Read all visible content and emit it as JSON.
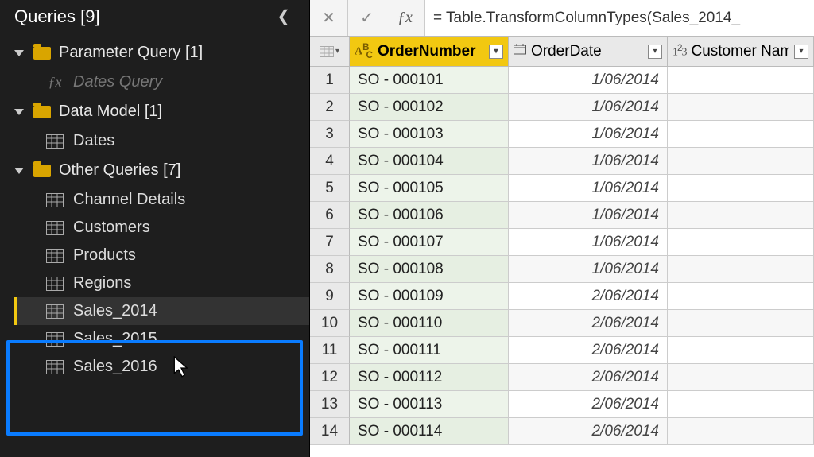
{
  "sidebar": {
    "title": "Queries [9]",
    "groups": [
      {
        "label": "Parameter Query [1]",
        "items": [
          {
            "label": "Dates Query",
            "kind": "fx",
            "dimmed": true
          }
        ]
      },
      {
        "label": "Data Model [1]",
        "items": [
          {
            "label": "Dates",
            "kind": "table"
          }
        ]
      },
      {
        "label": "Other Queries [7]",
        "items": [
          {
            "label": "Channel Details",
            "kind": "table"
          },
          {
            "label": "Customers",
            "kind": "table"
          },
          {
            "label": "Products",
            "kind": "table"
          },
          {
            "label": "Regions",
            "kind": "table"
          },
          {
            "label": "Sales_2014",
            "kind": "table",
            "selected": true
          },
          {
            "label": "Sales_2015",
            "kind": "table"
          },
          {
            "label": "Sales_2016",
            "kind": "table"
          }
        ]
      }
    ]
  },
  "formula": "= Table.TransformColumnTypes(Sales_2014_",
  "columns": [
    {
      "name": "OrderNumber",
      "type": "text",
      "selected": true
    },
    {
      "name": "OrderDate",
      "type": "date"
    },
    {
      "name": "Customer Name",
      "type": "number"
    }
  ],
  "rows": [
    {
      "n": 1,
      "order": "SO - 000101",
      "date": "1/06/2014",
      "cust": ""
    },
    {
      "n": 2,
      "order": "SO - 000102",
      "date": "1/06/2014",
      "cust": ""
    },
    {
      "n": 3,
      "order": "SO - 000103",
      "date": "1/06/2014",
      "cust": ""
    },
    {
      "n": 4,
      "order": "SO - 000104",
      "date": "1/06/2014",
      "cust": ""
    },
    {
      "n": 5,
      "order": "SO - 000105",
      "date": "1/06/2014",
      "cust": ""
    },
    {
      "n": 6,
      "order": "SO - 000106",
      "date": "1/06/2014",
      "cust": ""
    },
    {
      "n": 7,
      "order": "SO - 000107",
      "date": "1/06/2014",
      "cust": ""
    },
    {
      "n": 8,
      "order": "SO - 000108",
      "date": "1/06/2014",
      "cust": ""
    },
    {
      "n": 9,
      "order": "SO - 000109",
      "date": "2/06/2014",
      "cust": ""
    },
    {
      "n": 10,
      "order": "SO - 000110",
      "date": "2/06/2014",
      "cust": ""
    },
    {
      "n": 11,
      "order": "SO - 000111",
      "date": "2/06/2014",
      "cust": ""
    },
    {
      "n": 12,
      "order": "SO - 000112",
      "date": "2/06/2014",
      "cust": ""
    },
    {
      "n": 13,
      "order": "SO - 000113",
      "date": "2/06/2014",
      "cust": ""
    },
    {
      "n": 14,
      "order": "SO - 000114",
      "date": "2/06/2014",
      "cust": ""
    }
  ]
}
